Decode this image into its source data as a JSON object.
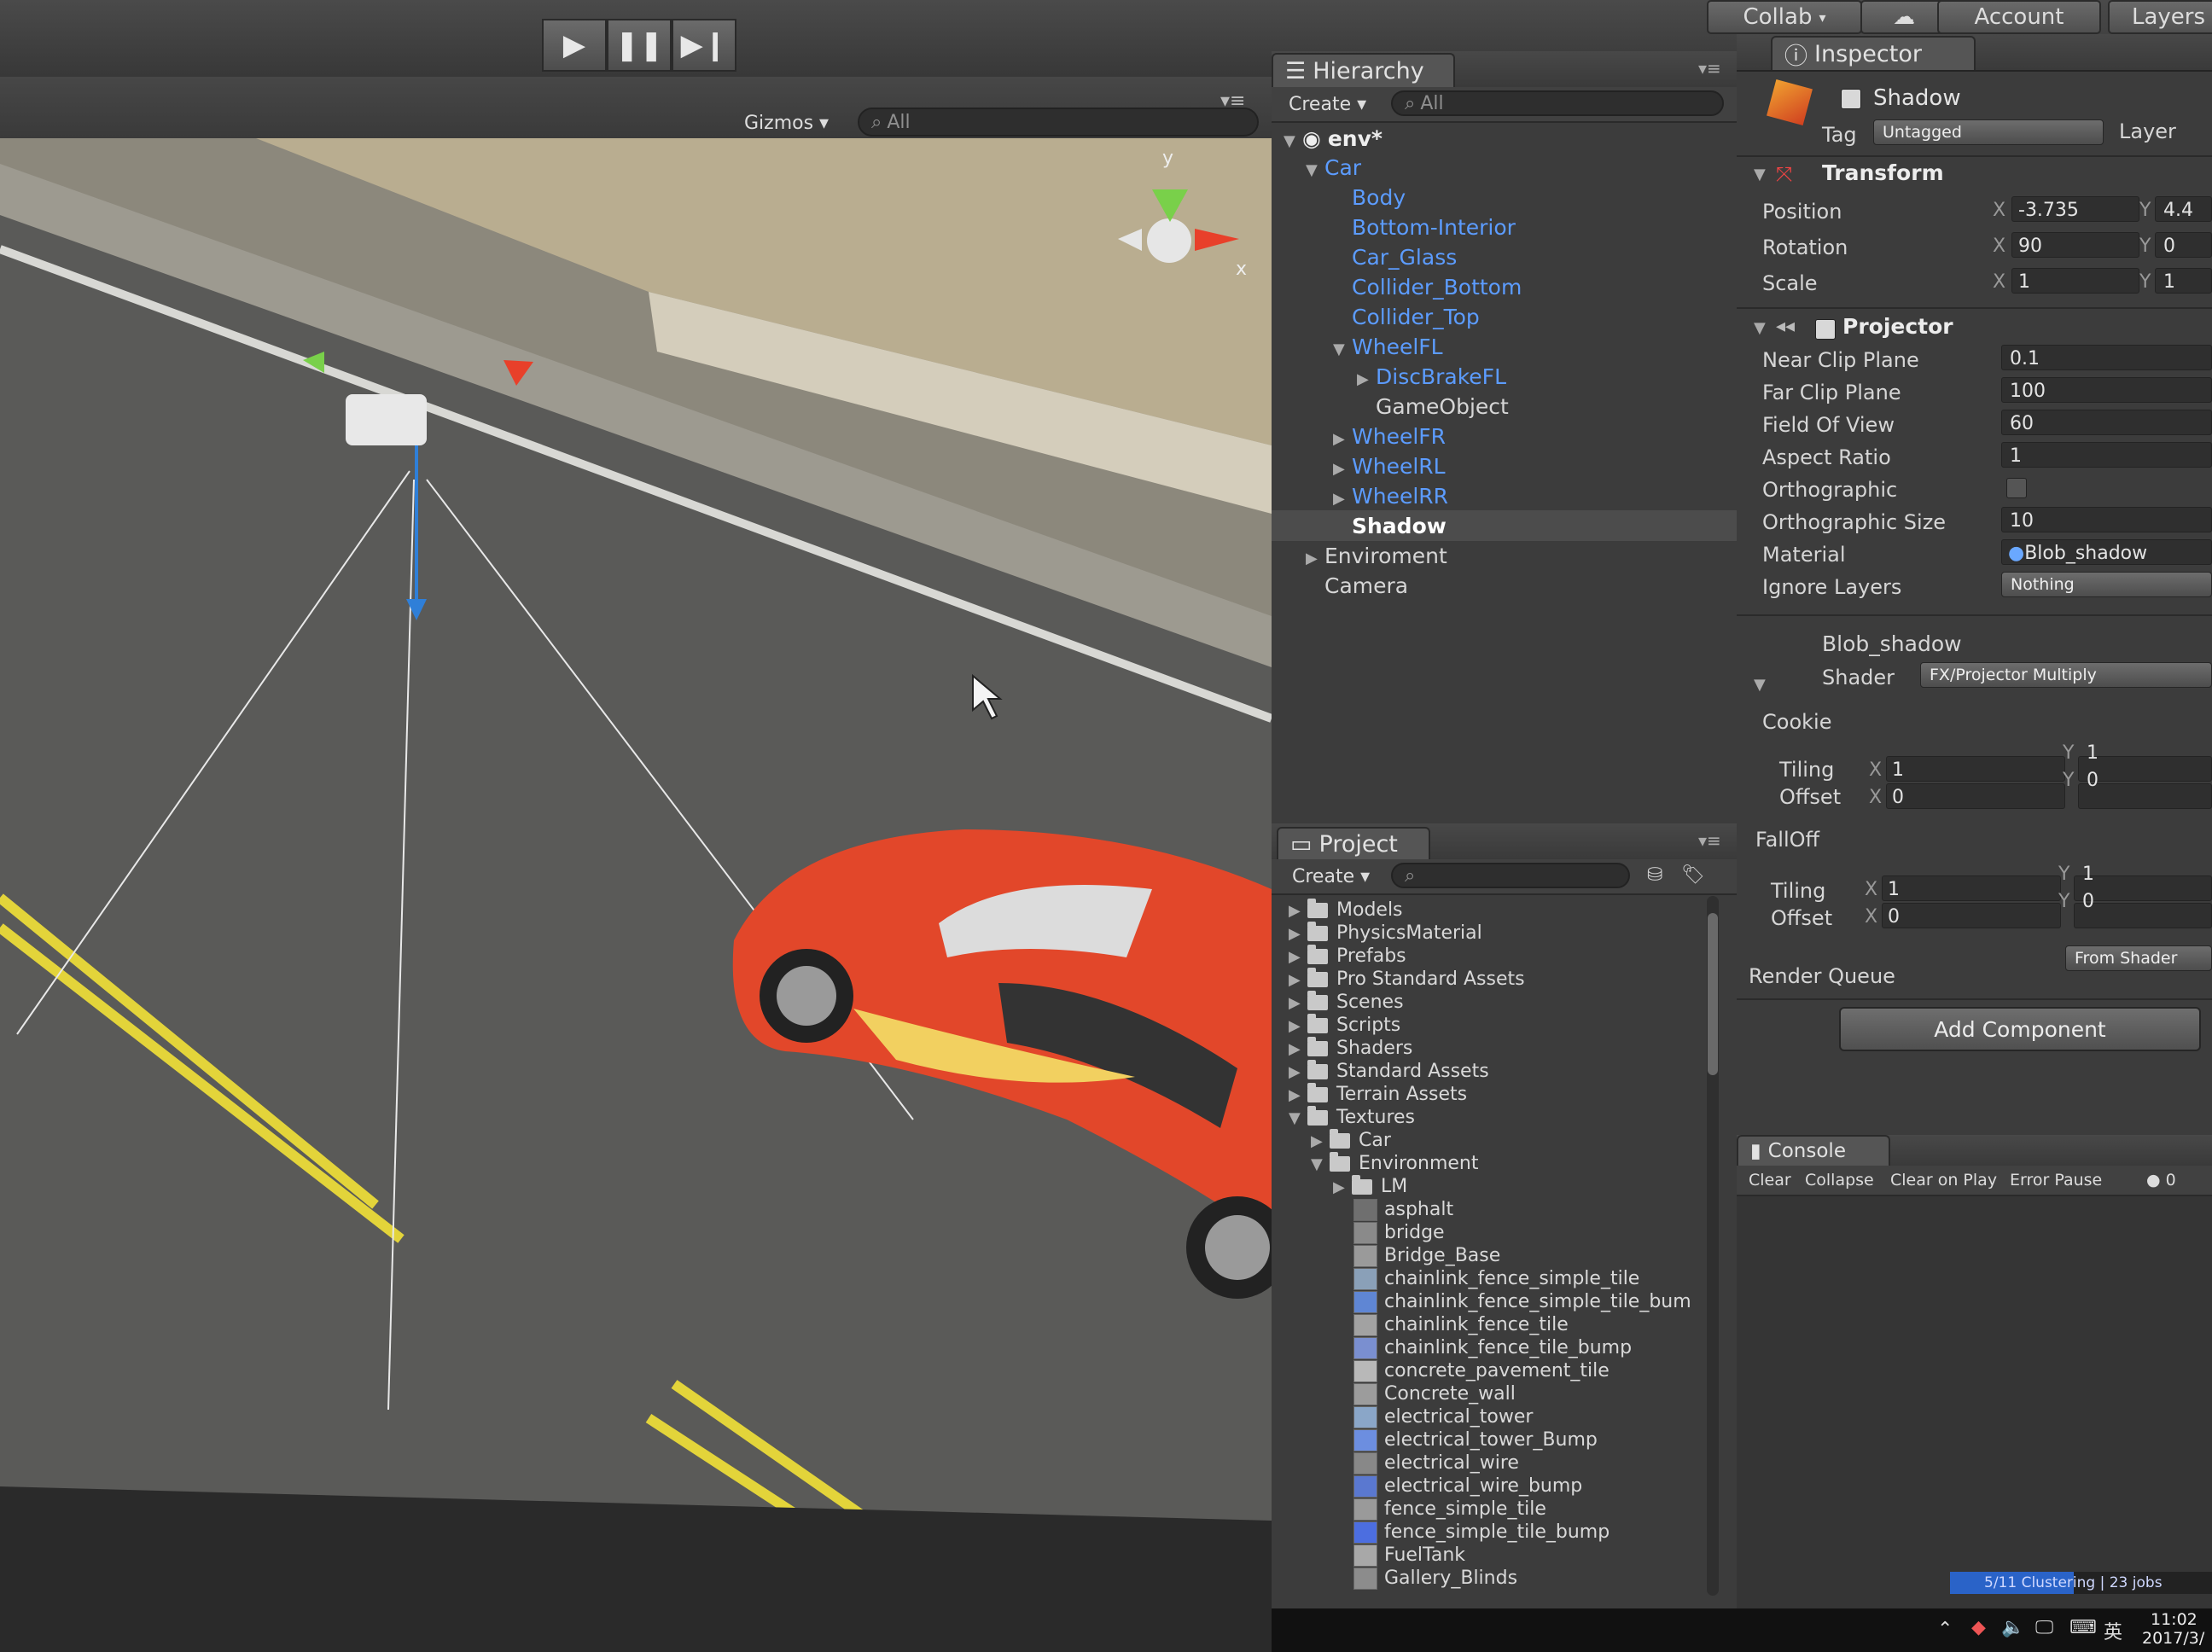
{
  "toolbar": {
    "play_icon": "play-icon",
    "pause_icon": "pause-icon",
    "step_icon": "step-icon",
    "collab_label": "Collab",
    "account_label": "Account",
    "layers_label": "Layers"
  },
  "scene": {
    "gizmos_label": "Gizmos",
    "search_placeholder": "All"
  },
  "hierarchy": {
    "tab_label": "Hierarchy",
    "create_label": "Create",
    "search_placeholder": "All",
    "scene_name": "env*",
    "items": [
      {
        "label": "Car",
        "type": "prefab",
        "expanded": true
      },
      {
        "label": "Body",
        "type": "prefab"
      },
      {
        "label": "Bottom-Interior",
        "type": "prefab"
      },
      {
        "label": "Car_Glass",
        "type": "prefab"
      },
      {
        "label": "Collider_Bottom",
        "type": "prefab"
      },
      {
        "label": "Collider_Top",
        "type": "prefab"
      },
      {
        "label": "WheelFL",
        "type": "prefab",
        "expanded": true
      },
      {
        "label": "DiscBrakeFL",
        "type": "prefab"
      },
      {
        "label": "GameObject",
        "type": "normal"
      },
      {
        "label": "WheelFR",
        "type": "prefab"
      },
      {
        "label": "WheelRL",
        "type": "prefab"
      },
      {
        "label": "WheelRR",
        "type": "prefab"
      },
      {
        "label": "Shadow",
        "type": "selected"
      },
      {
        "label": "Enviroment",
        "type": "normal"
      },
      {
        "label": "Camera",
        "type": "normal"
      }
    ]
  },
  "project": {
    "tab_label": "Project",
    "create_label": "Create",
    "folders": [
      {
        "label": "Models"
      },
      {
        "label": "PhysicsMaterial"
      },
      {
        "label": "Prefabs"
      },
      {
        "label": "Pro Standard Assets"
      },
      {
        "label": "Scenes"
      },
      {
        "label": "Scripts"
      },
      {
        "label": "Shaders"
      },
      {
        "label": "Standard Assets"
      },
      {
        "label": "Terrain Assets"
      },
      {
        "label": "Textures"
      },
      {
        "label": "Car"
      },
      {
        "label": "Environment"
      },
      {
        "label": "LM"
      }
    ],
    "textures": [
      {
        "label": "asphalt",
        "color": "#6f6f6f"
      },
      {
        "label": "bridge",
        "color": "#8a8a8a"
      },
      {
        "label": "Bridge_Base",
        "color": "#9a9a9a"
      },
      {
        "label": "chainlink_fence_simple_tile",
        "color": "#8aa0b8"
      },
      {
        "label": "chainlink_fence_simple_tile_bum",
        "color": "#5f86d4"
      },
      {
        "label": "chainlink_fence_tile",
        "color": "#a2a2a2"
      },
      {
        "label": "chainlink_fence_tile_bump",
        "color": "#7a8fd0"
      },
      {
        "label": "concrete_pavement_tile",
        "color": "#b8b8b8"
      },
      {
        "label": "Concrete_wall",
        "color": "#9c9c9c"
      },
      {
        "label": "electrical_tower",
        "color": "#8aa6c8"
      },
      {
        "label": "electrical_tower_Bump",
        "color": "#6c8ee0"
      },
      {
        "label": "electrical_wire",
        "color": "#888888"
      },
      {
        "label": "electrical_wire_bump",
        "color": "#5a78d0"
      },
      {
        "label": "fence_simple_tile",
        "color": "#9a9a9a"
      },
      {
        "label": "fence_simple_tile_bump",
        "color": "#4c6ee0"
      },
      {
        "label": "FuelTank",
        "color": "#a8a8a8"
      },
      {
        "label": "Gallery_Blinds",
        "color": "#8c8c8c"
      }
    ]
  },
  "inspector": {
    "tab_label": "Inspector",
    "object_name": "Shadow",
    "tag_label": "Tag",
    "tag_value": "Untagged",
    "layer_label": "Layer",
    "transform": {
      "title": "Transform",
      "position_label": "Position",
      "rotation_label": "Rotation",
      "scale_label": "Scale",
      "pos_x": "-3.735",
      "pos_y": "4.4",
      "rot_x": "90",
      "rot_y": "0",
      "scale_x": "1",
      "scale_y": "1"
    },
    "projector": {
      "title": "Projector",
      "near_label": "Near Clip Plane",
      "near": "0.1",
      "far_label": "Far Clip Plane",
      "far": "100",
      "fov_label": "Field Of View",
      "fov": "60",
      "aspect_label": "Aspect Ratio",
      "aspect": "1",
      "ortho_label": "Orthographic",
      "ortho_size_label": "Orthographic Size",
      "ortho_size": "10",
      "material_label": "Material",
      "material": "Blob_shadow",
      "ignore_label": "Ignore Layers",
      "ignore": "Nothing"
    },
    "material": {
      "name": "Blob_shadow",
      "shader_label": "Shader",
      "shader": "FX/Projector Multiply",
      "cookie_label": "Cookie",
      "falloff_label": "FallOff",
      "tiling_label": "Tiling",
      "offset_label": "Offset",
      "cookie_tiling_x": "1",
      "cookie_tiling_y": "1",
      "cookie_offset_x": "0",
      "cookie_offset_y": "0",
      "falloff_tiling_x": "1",
      "falloff_tiling_y": "1",
      "falloff_offset_x": "0",
      "falloff_offset_y": "0",
      "render_queue_label": "Render Queue",
      "render_queue": "From Shader"
    },
    "add_component_label": "Add Component"
  },
  "console": {
    "tab_label": "Console",
    "clear_label": "Clear",
    "collapse_label": "Collapse",
    "clear_on_play_label": "Clear on Play",
    "error_pause_label": "Error Pause",
    "count": "0"
  },
  "status": {
    "progress_text": "5/11 Clustering | 23 jobs"
  },
  "taskbar": {
    "time": "11:02",
    "date": "2017/3/",
    "ime": "英"
  },
  "axis_labels": {
    "x": "x",
    "y": "y"
  },
  "colors": {
    "prefab_blue": "#5c9cff",
    "car_red": "#e2472a",
    "lane_yellow": "#e3d43a",
    "gizmo_red": "#e8402a",
    "gizmo_green": "#79d04a",
    "gizmo_blue": "#2f7fd8"
  }
}
